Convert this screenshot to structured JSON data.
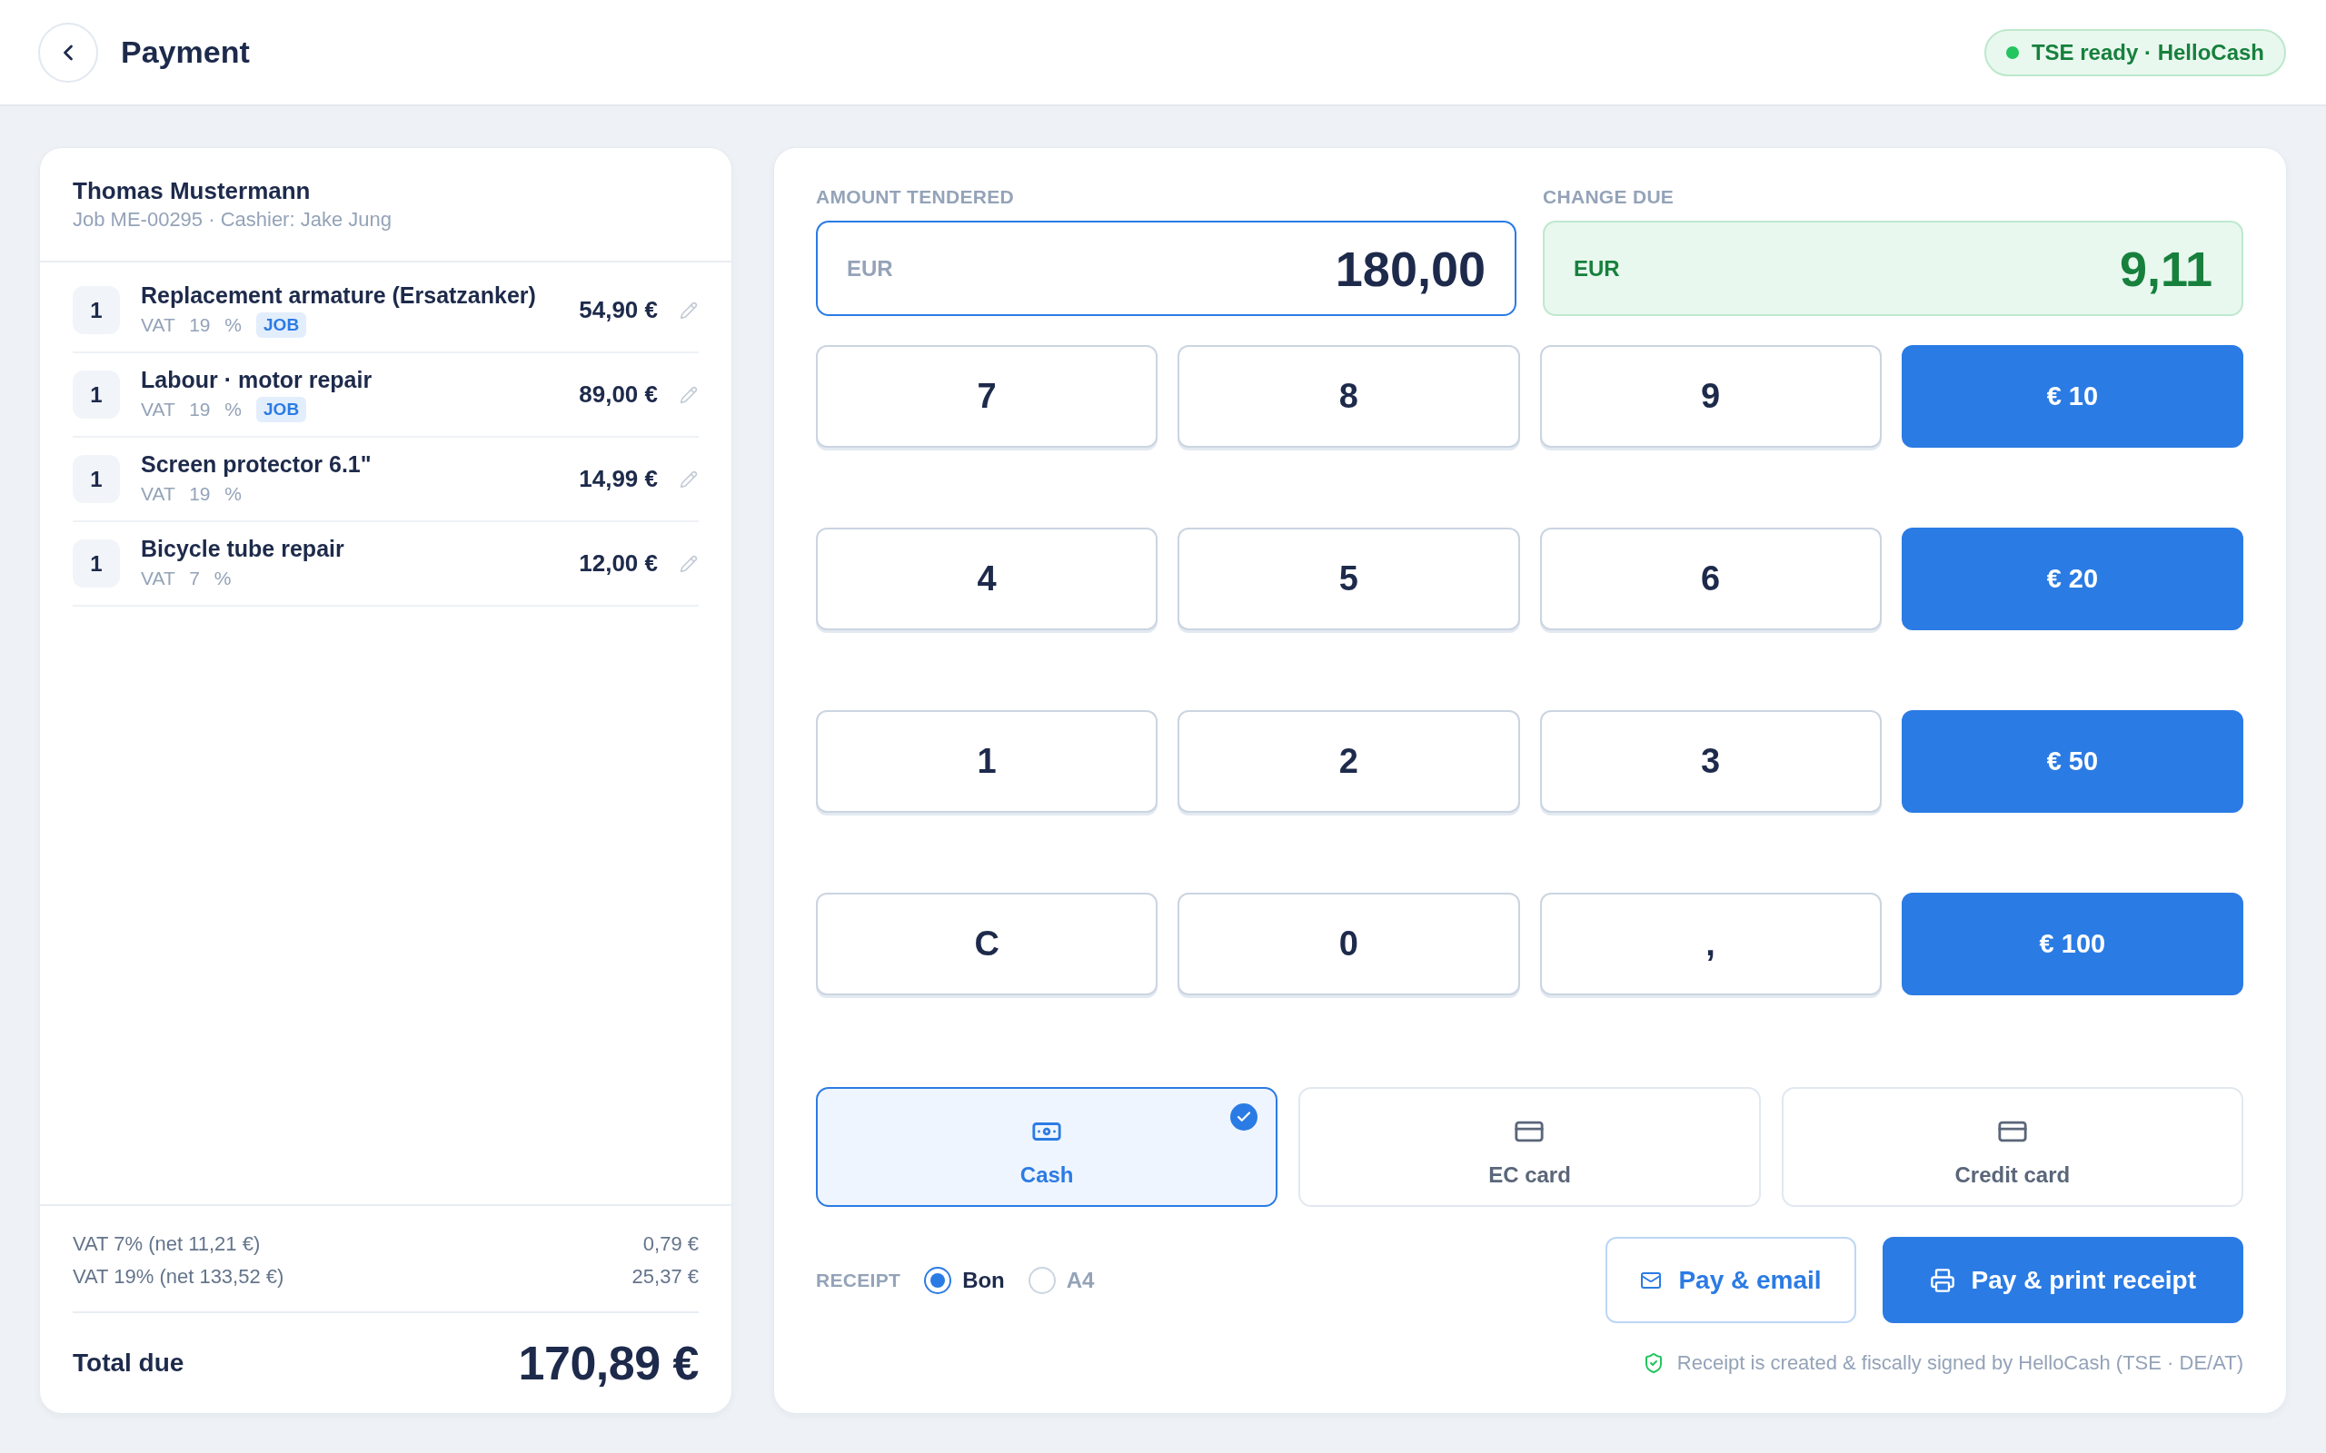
{
  "header": {
    "title": "Payment",
    "status_badge": "TSE ready · HelloCash"
  },
  "order": {
    "customer": "Thomas Mustermann",
    "details": "Job ME-00295 · Cashier: Jake Jung",
    "items": [
      {
        "qty": "1",
        "name": "Replacement armature (Ersatzanker)",
        "vat": "VAT 19 %",
        "tag": "JOB",
        "price": "54,90 €"
      },
      {
        "qty": "1",
        "name": "Labour · motor repair",
        "vat": "VAT 19 %",
        "tag": "JOB",
        "price": "89,00 €"
      },
      {
        "qty": "1",
        "name": "Screen protector 6.1\"",
        "vat": "VAT 19 %",
        "price": "14,99 €"
      },
      {
        "qty": "1",
        "name": "Bicycle tube repair",
        "vat": "VAT 7 %",
        "price": "12,00 €"
      }
    ],
    "vat_lines": [
      {
        "label": "VAT 7% (net 11,21 €)",
        "amount": "0,79 €"
      },
      {
        "label": "VAT 19% (net 133,52 €)",
        "amount": "25,37 €"
      }
    ],
    "total": {
      "label": "Total due",
      "amount": "170,89 €"
    }
  },
  "payment": {
    "fields": [
      {
        "kind": "tendered",
        "label": "AMOUNT TENDERED",
        "currency": "EUR",
        "value": "180,00"
      },
      {
        "kind": "change",
        "label": "CHANGE DUE",
        "currency": "EUR",
        "value": "9,11"
      }
    ],
    "keypad": [
      {
        "kind": "digit",
        "label": "7"
      },
      {
        "kind": "digit",
        "label": "8"
      },
      {
        "kind": "digit",
        "label": "9"
      },
      {
        "kind": "quick",
        "label": "€ 10"
      },
      {
        "kind": "digit",
        "label": "4"
      },
      {
        "kind": "digit",
        "label": "5"
      },
      {
        "kind": "digit",
        "label": "6"
      },
      {
        "kind": "quick",
        "label": "€ 20"
      },
      {
        "kind": "digit",
        "label": "1"
      },
      {
        "kind": "digit",
        "label": "2"
      },
      {
        "kind": "digit",
        "label": "3"
      },
      {
        "kind": "quick",
        "label": "€ 50"
      },
      {
        "kind": "digit",
        "label": "C"
      },
      {
        "kind": "digit",
        "label": "0"
      },
      {
        "kind": "digit",
        "label": ","
      },
      {
        "kind": "quick",
        "label": "€ 100"
      }
    ],
    "methods": [
      {
        "kind": "cash",
        "label": "Cash",
        "selected": true
      },
      {
        "kind": "card",
        "label": "EC card",
        "selected": false
      },
      {
        "kind": "card",
        "label": "Credit card",
        "selected": false
      }
    ],
    "receipt": {
      "label": "RECEIPT",
      "options": [
        {
          "label": "Bon",
          "selected": true
        },
        {
          "label": "A4",
          "selected": false
        }
      ]
    },
    "actions": [
      {
        "kind": "email",
        "label": "Pay & email"
      },
      {
        "kind": "print",
        "label": "Pay & print receipt"
      }
    ],
    "note": "Receipt is created & fiscally signed by HelloCash (TSE · DE/AT)"
  }
}
